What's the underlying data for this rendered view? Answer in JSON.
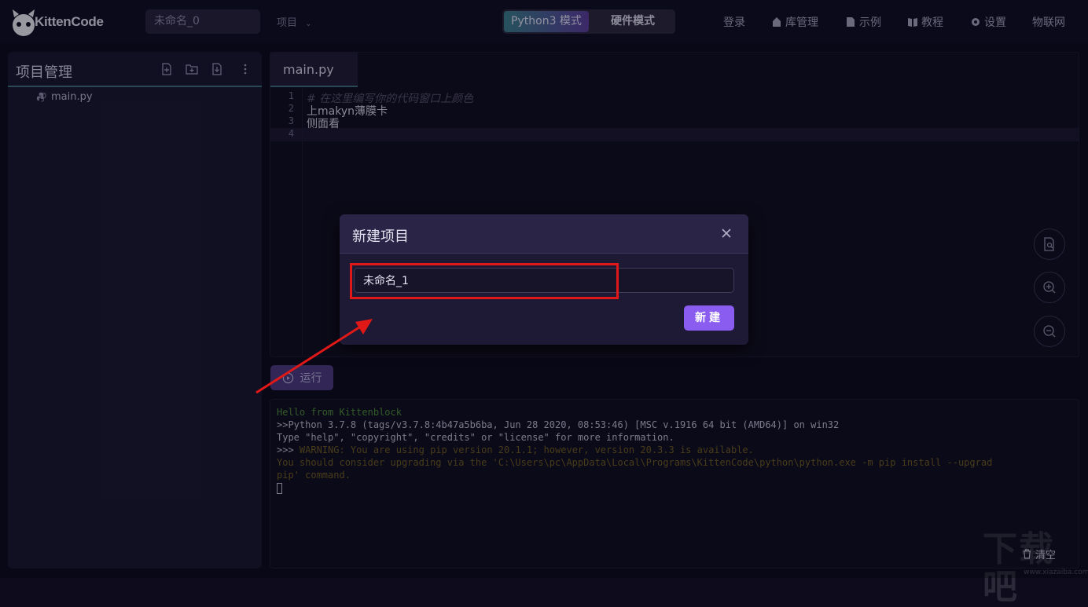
{
  "app": {
    "logo_text": "KittenCode",
    "project_name": "未命名_0",
    "project_menu": "项目"
  },
  "modes": {
    "python": "Python3 模式",
    "hardware": "硬件模式"
  },
  "nav": {
    "login": "登录",
    "library": "库管理",
    "examples": "示例",
    "tutorial": "教程",
    "settings": "设置",
    "iot": "物联网"
  },
  "sidebar": {
    "title": "项目管理",
    "files": [
      {
        "name": "main.py"
      }
    ]
  },
  "editor": {
    "tab": "main.py",
    "line_numbers": [
      "1",
      "2",
      "3",
      "4"
    ],
    "lines": [
      "# 在这里编写你的代码窗口上颜色",
      "上makyn薄膜卡",
      "侧面看",
      ""
    ]
  },
  "run_button": "运行",
  "console": {
    "lines": [
      "Hello from Kittenblock",
      ">>Python 3.7.8 (tags/v3.7.8:4b47a5b6ba, Jun 28 2020, 08:53:46) [MSC v.1916 64 bit (AMD64)] on win32",
      "Type \"help\", \"copyright\", \"credits\" or \"license\" for more information.",
      ">>> ",
      "WARNING: You are using pip version 20.1.1; however, version 20.3.3 is available.",
      "You should consider upgrading via the 'C:\\Users\\pc\\AppData\\Local\\Programs\\KittenCode\\python\\python.exe -m pip install --upgrad",
      "pip' command."
    ],
    "clear": "清空"
  },
  "dialog": {
    "title": "新建项目",
    "input_value": "未命名_1",
    "create": "新建"
  },
  "watermark": {
    "big": "下载吧",
    "small": "www.xiazaiba.com"
  },
  "colors": {
    "accent": "#8a5cf0",
    "highlight": "#e01818",
    "teal_line": "#3d6e7a"
  }
}
